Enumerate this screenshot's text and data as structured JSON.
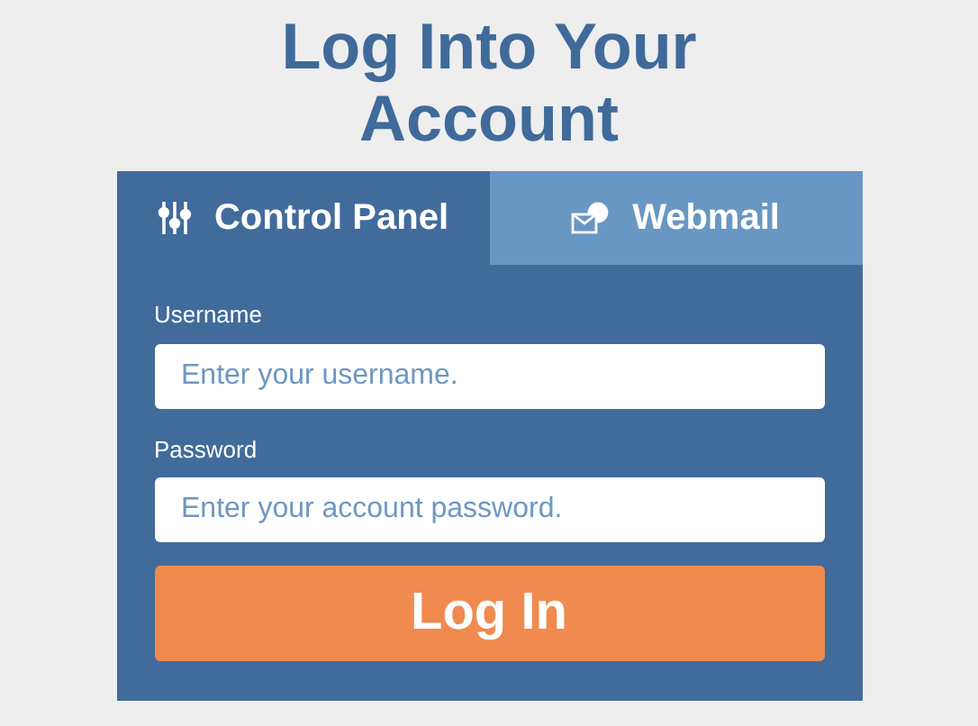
{
  "title": "Log Into Your Account",
  "tabs": [
    {
      "label": "Control Panel",
      "kind": "panel",
      "selected": true
    },
    {
      "label": "Webmail",
      "kind": "mail",
      "selected": false
    }
  ],
  "fields": [
    {
      "label": "Username",
      "placeholder": "Enter your username."
    },
    {
      "label": "Password",
      "placeholder": "Enter your account password."
    }
  ],
  "button": "Log In"
}
